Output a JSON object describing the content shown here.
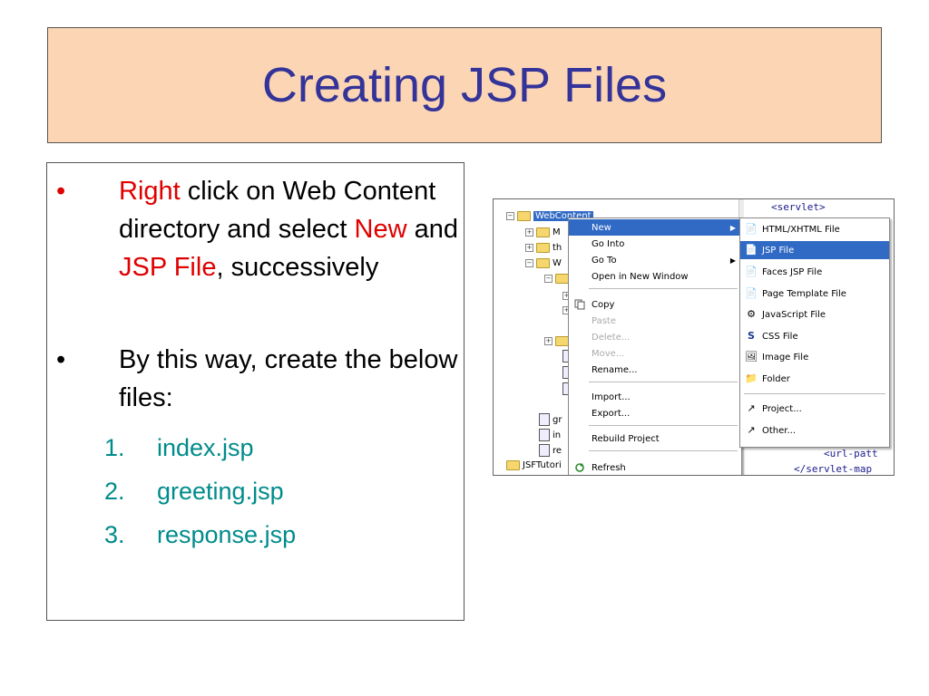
{
  "title": "Creating JSP Files",
  "bullets": {
    "b1": {
      "marker": "•",
      "w1": "Right",
      "t1": " click on Web Content directory and select ",
      "w2": "New",
      "t2": " and ",
      "w3": "JSP File",
      "t3": ", successively"
    },
    "b2": {
      "marker": "•",
      "text": "By this way, create the below files:"
    }
  },
  "files": [
    {
      "num": "1.",
      "name": "index.jsp"
    },
    {
      "num": "2.",
      "name": "greeting.jsp"
    },
    {
      "num": "3.",
      "name": "response.jsp"
    }
  ],
  "screenshot": {
    "tree": {
      "webcontent": "WebContent",
      "item_m": "M",
      "item_th": "th",
      "item_w": "W",
      "item_gr": "gr",
      "item_in": "in",
      "item_re": "re",
      "project": "JSFTutori"
    },
    "code": {
      "line1": "<servlet>",
      "line2": "<url-patt",
      "line3": "</servlet-map"
    },
    "menu": {
      "new": "New",
      "go_into": "Go Into",
      "go_to": "Go To",
      "open_new_window": "Open in New Window",
      "copy": "Copy",
      "paste": "Paste",
      "delete": "Delete...",
      "move": "Move...",
      "rename": "Rename...",
      "import": "Import...",
      "export": "Export...",
      "rebuild": "Rebuild Project",
      "refresh": "Refresh"
    },
    "submenu": {
      "html": "HTML/XHTML File",
      "jsp": "JSP File",
      "faces_jsp": "Faces JSP File",
      "page_template": "Page Template File",
      "javascript": "JavaScript File",
      "css": "CSS File",
      "image": "Image File",
      "folder": "Folder",
      "project": "Project...",
      "other": "Other..."
    }
  },
  "colors": {
    "title": "#333399",
    "title_bg": "#fcd5b4",
    "highlight": "#e00000",
    "list": "#008b8b",
    "selection": "#316ac5"
  }
}
